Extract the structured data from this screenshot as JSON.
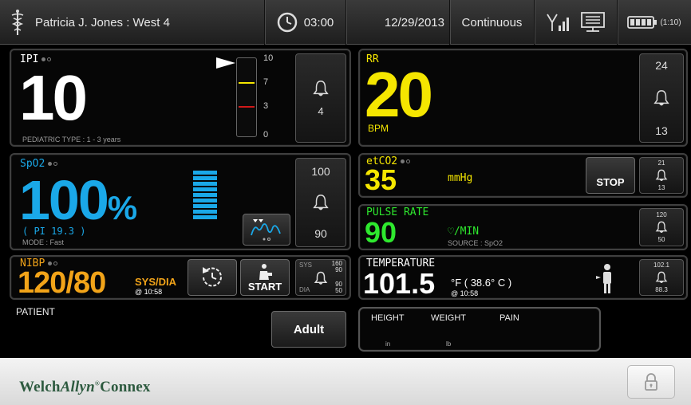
{
  "topbar": {
    "patient_name": "Patricia J. Jones : West 4",
    "time": "03:00",
    "date": "12/29/2013",
    "mode": "Continuous",
    "battery_label": "(1:10)"
  },
  "ipi": {
    "label": "IPI",
    "value": "10",
    "type_text": "PEDIATRIC TYPE : 1 - 3 years",
    "scale": [
      "10",
      "7",
      "3",
      "0"
    ],
    "alarm_value": "4"
  },
  "rr": {
    "label": "RR",
    "value": "20",
    "unit": "BPM",
    "alarm_high": "24",
    "alarm_low": "13"
  },
  "spo2": {
    "label": "SpO2",
    "value": "100",
    "unit": "%",
    "pi": "( PI 19.3 )",
    "mode": "MODE : Fast",
    "alarm_high": "100",
    "alarm_low": "90"
  },
  "etco2": {
    "label": "etCO2",
    "value": "35",
    "unit": "mmHg",
    "stop_label": "STOP",
    "alarm_high": "21",
    "alarm_low": "13"
  },
  "pulse": {
    "label": "PULSE RATE",
    "value": "90",
    "unit": "/MIN",
    "source": "SOURCE : SpO2",
    "alarm_high": "120",
    "alarm_low": "50"
  },
  "nibp": {
    "label": "NIBP",
    "value": "120/80",
    "unit": "SYS/DIA",
    "time": "@ 10:58",
    "start_label": "START",
    "sys_label": "SYS",
    "dia_label": "DIA",
    "sys_high": "160",
    "sys_low": "90",
    "dia_high": "90",
    "dia_low": "50"
  },
  "temperature": {
    "label": "TEMPERATURE",
    "value": "101.5",
    "unit": "°F",
    "celsius": "( 38.6° C )",
    "time": "@ 10:58",
    "alarm_high": "102.1",
    "alarm_low": "88.3"
  },
  "patient": {
    "label": "PATIENT",
    "type_button": "Adult",
    "height_label": "HEIGHT",
    "height_unit": "in",
    "weight_label": "WEIGHT",
    "weight_unit": "lb",
    "pain_label": "PAIN"
  },
  "footer": {
    "brand_welch": "Welch",
    "brand_allyn": "Allyn",
    "brand_connex": "Connex"
  },
  "colors": {
    "ipi": "#ffffff",
    "rr": "#f5e600",
    "spo2": "#1aa8e8",
    "etco2": "#f5e600",
    "pulse": "#2ee82e",
    "nibp": "#f2a419",
    "temperature": "#ffffff"
  },
  "icons": [
    "caduceus-icon",
    "clock-icon",
    "signal-icon",
    "network-icon",
    "battery-icon",
    "bell-icon",
    "waveform-icon",
    "nibp-interval-icon",
    "person-icon",
    "lock-icon"
  ]
}
